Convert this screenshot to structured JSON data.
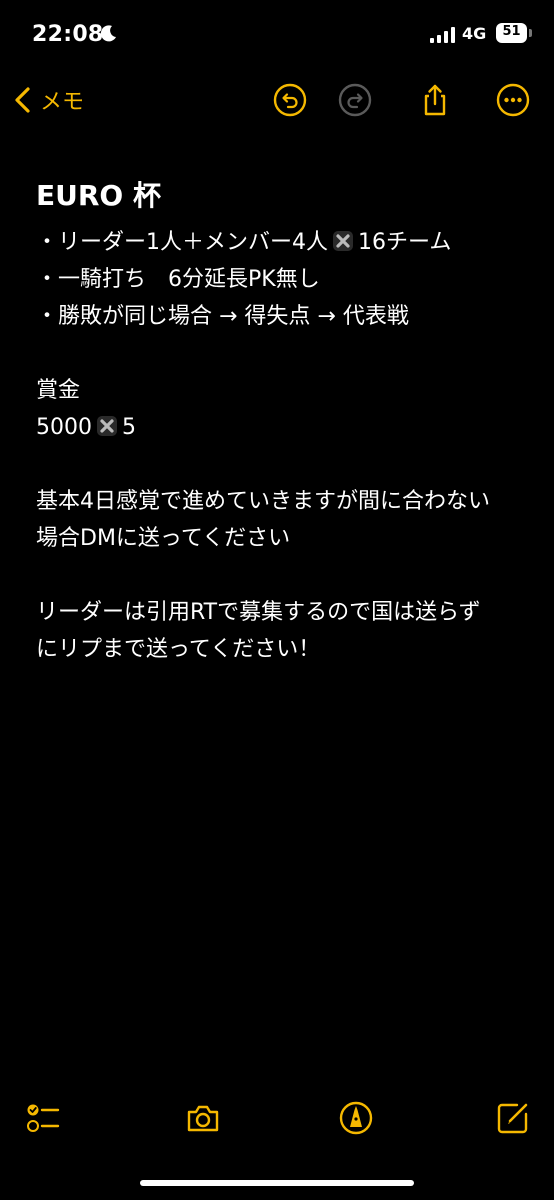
{
  "status_bar": {
    "time": "22:08",
    "network": "4G",
    "battery": "51"
  },
  "nav": {
    "back_label": "メモ",
    "accent_color": "#f5b800"
  },
  "note": {
    "title": "EURO 杯",
    "lines": [
      {
        "text": "・リーダー1人＋メンバー4人",
        "suffix": "16チーム",
        "has_x": true
      },
      {
        "text": "・一騎打ち　6分延長PK無し",
        "suffix": "",
        "has_x": false
      },
      {
        "text": "・勝敗が同じ場合 → 得失点 → 代表戦",
        "suffix": "",
        "has_x": false
      },
      {
        "text": "",
        "suffix": "",
        "has_x": false
      },
      {
        "text": "賞金",
        "suffix": "",
        "has_x": false
      },
      {
        "text": "5000",
        "suffix": "5",
        "has_x": true
      },
      {
        "text": "",
        "suffix": "",
        "has_x": false
      },
      {
        "text": "基本4日感覚で進めていきますが間に合わない",
        "suffix": "",
        "has_x": false
      },
      {
        "text": "場合DMに送ってください",
        "suffix": "",
        "has_x": false
      },
      {
        "text": "",
        "suffix": "",
        "has_x": false
      },
      {
        "text": "リーダーは引用RTで募集するので国は送らず",
        "suffix": "",
        "has_x": false
      },
      {
        "text": "にリプまで送ってください！",
        "suffix": "",
        "has_x": false
      }
    ]
  },
  "icons": {
    "back": "chevron-left-icon",
    "undo": "undo-icon",
    "redo": "redo-icon",
    "share": "share-icon",
    "more": "more-icon",
    "checklist": "checklist-icon",
    "camera": "camera-icon",
    "markup": "markup-icon",
    "compose": "compose-icon"
  }
}
